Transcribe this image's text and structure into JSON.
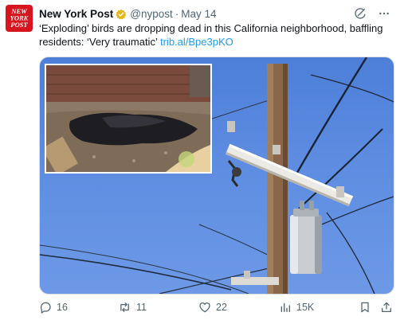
{
  "account": {
    "name": "New York Post",
    "handle": "@nypost",
    "separator": "·",
    "date": "May 14",
    "avatar_text": [
      "NEW",
      "YORK",
      "POST"
    ]
  },
  "tweet": {
    "text": "‘Exploding’ birds are dropping dead in this California neighborhood, baffling residents: ‘Very traumatic’",
    "link": "trib.al/Bpe3pKO"
  },
  "actions": {
    "replies": "16",
    "reposts": "11",
    "likes": "22",
    "views": "15K"
  },
  "icons": {
    "verified": "verified-badge-icon",
    "grok": "grok-icon",
    "more": "more-icon",
    "reply": "reply-icon",
    "repost": "repost-icon",
    "like": "like-icon",
    "views": "views-icon",
    "bookmark": "bookmark-icon",
    "share": "share-icon"
  },
  "colors": {
    "brand_red": "#d7151f",
    "link_blue": "#1d9bf0",
    "verified_gold": "#e2b719",
    "muted_text": "#536471"
  }
}
